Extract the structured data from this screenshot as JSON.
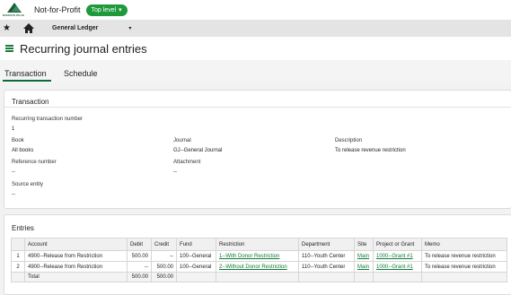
{
  "app": {
    "logo_text": "MISSION PEAK",
    "entity_name": "Not-for-Profit",
    "level_badge": "Top level",
    "module": "General Ledger",
    "page_title": "Recurring journal entries"
  },
  "tabs": [
    {
      "label": "Transaction",
      "active": true
    },
    {
      "label": "Schedule",
      "active": false
    }
  ],
  "transaction": {
    "section_title": "Transaction",
    "recurring_number_label": "Recurring transaction number",
    "recurring_number_value": "1",
    "book_label": "Book",
    "book_value": "All books",
    "journal_label": "Journal",
    "journal_value": "GJ--General Journal",
    "description_label": "Description",
    "description_value": "To release revenue restriction",
    "reference_label": "Reference number",
    "reference_value": "--",
    "attachment_label": "Attachment",
    "attachment_value": "--",
    "source_label": "Source entity",
    "source_value": "--"
  },
  "entries": {
    "section_title": "Entries",
    "columns": [
      "",
      "Account",
      "Debit",
      "Credit",
      "Fund",
      "Restriction",
      "Department",
      "Site",
      "Project or Grant",
      "Memo"
    ],
    "rows": [
      {
        "n": "1",
        "account": "4900--Release from Restriction",
        "debit": "500.00",
        "credit": "--",
        "fund": "100--General",
        "restriction": "1--With Donor Restriction",
        "department": "110--Youth Center",
        "site": "Main",
        "project": "1000--Grant #1",
        "memo": "To release revenue restriction"
      },
      {
        "n": "2",
        "account": "4900--Release from Restriction",
        "debit": "--",
        "credit": "500.00",
        "fund": "100--General",
        "restriction": "2--Without Donor Restriction",
        "department": "110--Youth Center",
        "site": "Main",
        "project": "1000--Grant #1",
        "memo": "To release revenue restriction"
      }
    ],
    "total_label": "Total",
    "total_debit": "500.00",
    "total_credit": "500.00"
  },
  "colors": {
    "accent_green": "#1e9a3c",
    "link_green": "#0f7a38",
    "tab_underline": "#0b6b3c"
  }
}
